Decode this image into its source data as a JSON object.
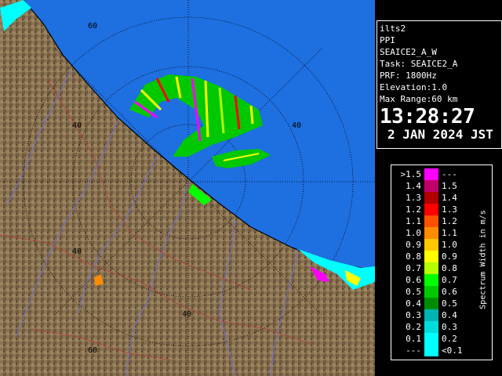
{
  "info": {
    "site": "ilts2",
    "mode": "PPI",
    "product": "SEAICE2_A_W",
    "task": "Task: SEAICE2_A",
    "prf": "PRF: 1800Hz",
    "elevation": "Elevation:1.0",
    "max_range": "Max Range:60 km",
    "time": "13:28:27",
    "date": "2 JAN 2024 JST"
  },
  "range_labels": [
    "60",
    "40",
    "40",
    "40",
    "40",
    "60"
  ],
  "legend": {
    "title": "Spectrum Width in m/s",
    "rows": [
      {
        "left": ">1.5",
        "right": "---",
        "color": "#ff00ff"
      },
      {
        "left": "1.4",
        "right": "1.5",
        "color": "#c0006a"
      },
      {
        "left": "1.3",
        "right": "1.4",
        "color": "#b00000"
      },
      {
        "left": "1.2",
        "right": "1.3",
        "color": "#ff0000"
      },
      {
        "left": "1.1",
        "right": "1.2",
        "color": "#ff5000"
      },
      {
        "left": "1.0",
        "right": "1.1",
        "color": "#ff8c00"
      },
      {
        "left": "0.9",
        "right": "1.0",
        "color": "#ffc800"
      },
      {
        "left": "0.8",
        "right": "0.9",
        "color": "#ffff00"
      },
      {
        "left": "0.7",
        "right": "0.8",
        "color": "#b4ff00"
      },
      {
        "left": "0.6",
        "right": "0.7",
        "color": "#00ff00"
      },
      {
        "left": "0.5",
        "right": "0.6",
        "color": "#00c800"
      },
      {
        "left": "0.4",
        "right": "0.5",
        "color": "#008c00"
      },
      {
        "left": "0.3",
        "right": "0.4",
        "color": "#00b4b4"
      },
      {
        "left": "0.2",
        "right": "0.3",
        "color": "#00dcdc"
      },
      {
        "left": "0.1",
        "right": "0.2",
        "color": "#00ffff"
      },
      {
        "left": "---",
        "right": "<0.1",
        "color": "#00ffff"
      }
    ]
  },
  "colors": {
    "sea": "#1e6fe0",
    "land": "#8a7352",
    "land_dark": "#5a4630",
    "rivers": "#7070d0",
    "roads": "#b04040",
    "rings": "#000000"
  }
}
